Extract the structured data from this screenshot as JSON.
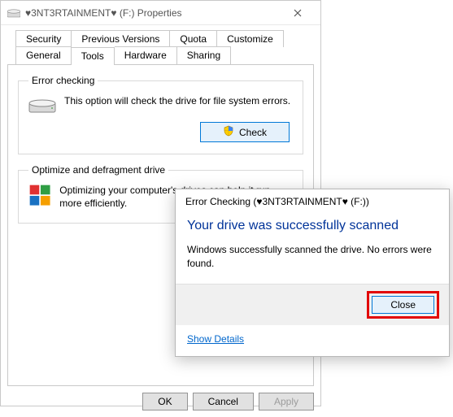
{
  "properties_window": {
    "title": "♥3NT3RTAINMENT♥ (F:) Properties",
    "tabs_row1": [
      "Security",
      "Previous Versions",
      "Quota",
      "Customize"
    ],
    "tabs_row2": [
      "General",
      "Tools",
      "Hardware",
      "Sharing"
    ],
    "selected_tab": "Tools",
    "error_checking": {
      "legend": "Error checking",
      "desc": "This option will check the drive for file system errors.",
      "button": "Check"
    },
    "optimize": {
      "legend": "Optimize and defragment drive",
      "desc": "Optimizing your computer's drives can help it run more efficiently."
    },
    "footer": {
      "ok": "OK",
      "cancel": "Cancel",
      "apply": "Apply"
    }
  },
  "error_dialog": {
    "title": "Error Checking (♥3NT3RTAINMENT♥ (F:))",
    "headline": "Your drive was successfully scanned",
    "body": "Windows successfully scanned the drive. No errors were found.",
    "close": "Close",
    "show_details": "Show Details"
  }
}
